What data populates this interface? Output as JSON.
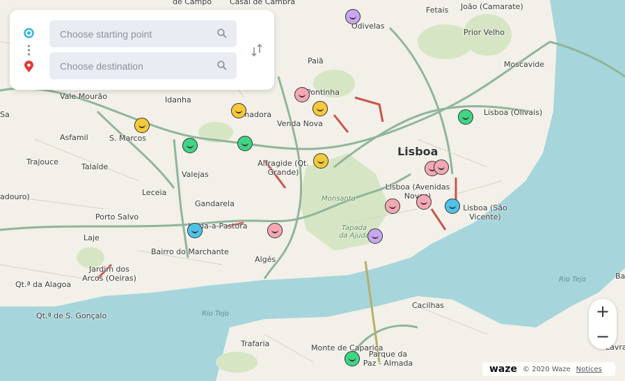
{
  "search": {
    "start_placeholder": "Choose starting point",
    "destination_placeholder": "Choose destination"
  },
  "map": {
    "labels": [
      "de Campo",
      "Casal de Cambra",
      "Fetais",
      "João (Camarate)",
      "Prior Velho",
      "Moscavide",
      "Odivelas",
      "Paiã",
      "Pontinha",
      "Vale Mourão",
      "Idanha",
      "Amadora",
      "Venda Nova",
      "Lisboa (Olivais)",
      "Asfamil",
      "S. Marcos",
      "Lisboa",
      "Trajouce",
      "Talaíde",
      "Valejas",
      "Alfragide (Qt. Grande)",
      "Leceia",
      "Gandarela",
      "Lisboa (Avenidas Novas)",
      "Lisboa (São Vicente)",
      "Porto Salvo",
      "Laje",
      "Linda-a-Pastora",
      "Bairro do Marchante",
      "Algés",
      "Jardim dos Arcos (Oeiras)",
      "Qt.ª da Alagoa",
      "Qt.ª de S. Gonçalo",
      "Cacilhas",
      "Trafaria",
      "Monte de Caparica",
      "Parque da Paz - Almada",
      "Lavra",
      "Ba",
      "Sa",
      "adouro)"
    ],
    "water_labels": [
      "Rio Tejo",
      "Rio Tejo"
    ],
    "park_labels": [
      "Monsanto",
      "Tapada da Ajuda"
    ],
    "colors": {
      "land": "#f2f0e8",
      "water": "#a6d5dc",
      "park": "#d6e6c4",
      "road": "#8fb59a",
      "traffic": "#c9534f"
    }
  },
  "zoom": {
    "in": "+",
    "out": "−"
  },
  "footer": {
    "logo": "waze",
    "copyright": "© 2020 Waze",
    "notices": "Notices"
  }
}
